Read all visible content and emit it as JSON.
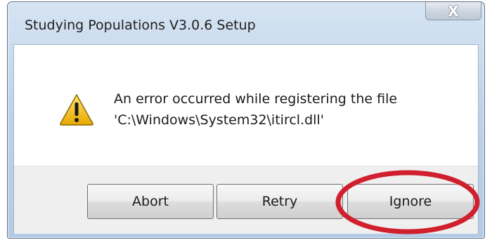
{
  "window": {
    "title": "Studying Populations V3.0.6 Setup",
    "close_icon": "close-icon",
    "close_glyph": "X"
  },
  "message": {
    "icon": "warning-icon",
    "line1": "An error occurred while registering the file",
    "line2": "'C:\\Windows\\System32\\itircl.dll'"
  },
  "buttons": {
    "abort": "Abort",
    "retry": "Retry",
    "ignore": "Ignore"
  },
  "colors": {
    "highlight": "#d0202e",
    "warning_fill": "#f6c51c",
    "warning_border": "#8a6a00"
  }
}
